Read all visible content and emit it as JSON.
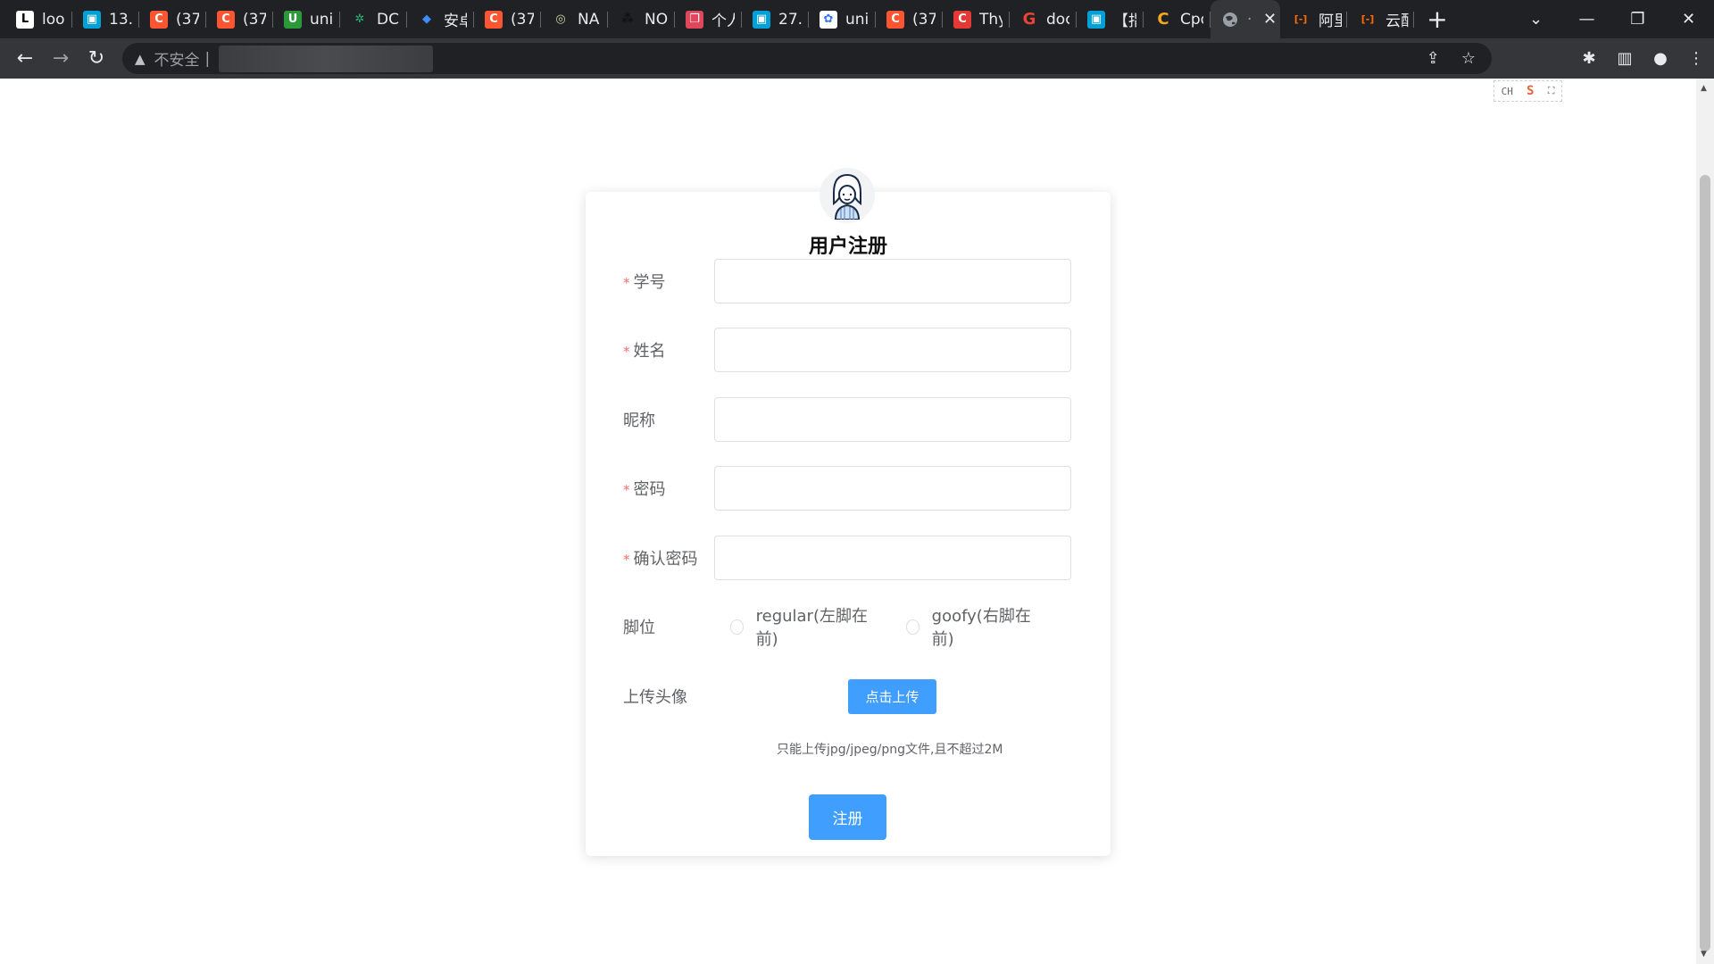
{
  "browser": {
    "tabs": [
      {
        "title": "loo",
        "favicon_char": "L",
        "favicon_color": "#ffffff",
        "favicon_text_color": "#000000"
      },
      {
        "title": "13.",
        "favicon_char": "▣",
        "favicon_color": "#00a1d6",
        "favicon_text_color": "#ffffff"
      },
      {
        "title": "(37",
        "favicon_char": "C",
        "favicon_color": "#fc5531",
        "favicon_text_color": "#ffffff"
      },
      {
        "title": "(37",
        "favicon_char": "C",
        "favicon_color": "#fc5531",
        "favicon_text_color": "#ffffff"
      },
      {
        "title": "uni",
        "favicon_char": "U",
        "favicon_color": "#2b9939",
        "favicon_text_color": "#ffffff"
      },
      {
        "title": "DCl",
        "favicon_char": "✲",
        "favicon_color": "#202124",
        "favicon_text_color": "#2bb673"
      },
      {
        "title": "安卓",
        "favicon_char": "◆",
        "favicon_color": "#202124",
        "favicon_text_color": "#3f8cff"
      },
      {
        "title": "(37",
        "favicon_char": "C",
        "favicon_color": "#fc5531",
        "favicon_text_color": "#ffffff"
      },
      {
        "title": "NA",
        "favicon_char": "◎",
        "favicon_color": "#202124",
        "favicon_text_color": "#c8d6a0"
      },
      {
        "title": "NO",
        "favicon_char": "⁂",
        "favicon_color": "#202124",
        "favicon_text_color": "#111111"
      },
      {
        "title": "个人",
        "favicon_char": "❐",
        "favicon_color": "#e0465c",
        "favicon_text_color": "#ffffff"
      },
      {
        "title": "27.",
        "favicon_char": "▣",
        "favicon_color": "#00a1d6",
        "favicon_text_color": "#ffffff"
      },
      {
        "title": "uni",
        "favicon_char": "✿",
        "favicon_color": "#ffffff",
        "favicon_text_color": "#3773ff"
      },
      {
        "title": "(37",
        "favicon_char": "C",
        "favicon_color": "#fc5531",
        "favicon_text_color": "#ffffff"
      },
      {
        "title": "Thy",
        "favicon_char": "C",
        "favicon_color": "#e53935",
        "favicon_text_color": "#ffffff"
      },
      {
        "title": "doc",
        "favicon_char": "G",
        "favicon_color": "#202124",
        "favicon_text_color": "#ea4335"
      },
      {
        "title": "【指",
        "favicon_char": "▣",
        "favicon_color": "#00a1d6",
        "favicon_text_color": "#ffffff"
      },
      {
        "title": "Cpo",
        "favicon_char": "C",
        "favicon_color": "#202124",
        "favicon_text_color": "#f5a623"
      }
    ],
    "active_tab": {
      "favicon": "globe-icon",
      "close": "✕"
    },
    "tabs_after": [
      {
        "title": "阿里",
        "favicon_char": "[-]",
        "favicon_color": "#202124",
        "favicon_text_color": "#ff6a00"
      },
      {
        "title": "云配",
        "favicon_char": "[-]",
        "favicon_color": "#202124",
        "favicon_text_color": "#ff6a00"
      }
    ],
    "new_tab": "+",
    "window_controls": {
      "dropdown": "⌄",
      "minimize": "—",
      "restore": "❐",
      "close": "✕"
    },
    "nav": {
      "back": "←",
      "forward": "→",
      "reload": "↻"
    },
    "omnibox": {
      "security_icon": "▲",
      "security_text": "不安全",
      "separator": "|",
      "share": "⇪",
      "star": "☆"
    },
    "toolbar_icons": {
      "extensions": "✱",
      "sidepanel": "▥",
      "profile": "●",
      "menu": "⋮"
    }
  },
  "ime": {
    "lang": "CH",
    "logo": "S",
    "expand": "⛶"
  },
  "form": {
    "title": "用户注册",
    "fields": [
      {
        "label": "学号",
        "required": true,
        "value": ""
      },
      {
        "label": "姓名",
        "required": true,
        "value": ""
      },
      {
        "label": "昵称",
        "required": false,
        "value": ""
      },
      {
        "label": "密码",
        "required": true,
        "value": ""
      },
      {
        "label": "确认密码",
        "required": true,
        "value": ""
      }
    ],
    "required_mark": "*",
    "stance": {
      "label": "脚位",
      "options": [
        "regular(左脚在前)",
        "goofy(右脚在前)"
      ],
      "selected": null
    },
    "upload": {
      "label": "上传头像",
      "button": "点击上传",
      "tip": "只能上传jpg/jpeg/png文件,且不超过2M"
    },
    "submit": "注册"
  },
  "colors": {
    "primary": "#409eff",
    "required": "#f56c6c",
    "text": "#606266",
    "border": "#dcdfe6"
  }
}
